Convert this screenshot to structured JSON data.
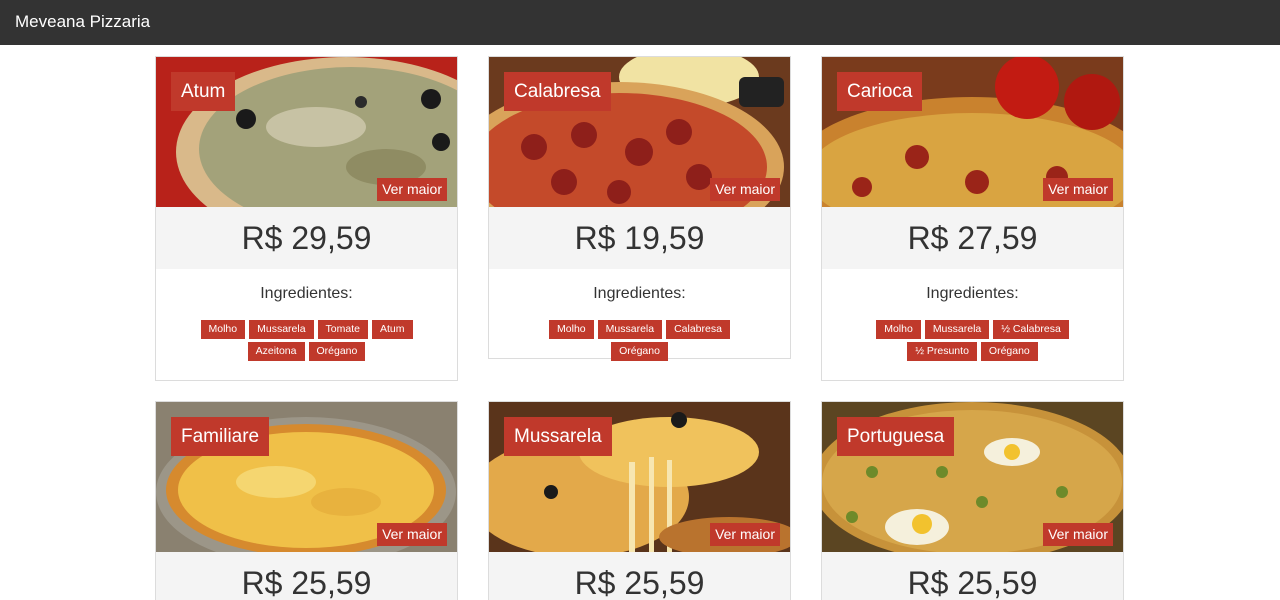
{
  "navbar": {
    "brand": "Meveana Pizzaria"
  },
  "more_label": "Ver maior",
  "ingredients_label": "Ingredientes:",
  "cards": [
    {
      "name": "Atum",
      "price": "R$ 29,59",
      "ingredients": [
        "Molho",
        "Mussarela",
        "Tomate",
        "Atum",
        "Azeitona",
        "Orégano"
      ]
    },
    {
      "name": "Calabresa",
      "price": "R$ 19,59",
      "ingredients": [
        "Molho",
        "Mussarela",
        "Calabresa",
        "Orégano"
      ]
    },
    {
      "name": "Carioca",
      "price": "R$ 27,59",
      "ingredients": [
        "Molho",
        "Mussarela",
        "½ Calabresa",
        "½ Presunto",
        "Orégano"
      ]
    },
    {
      "name": "Familiare",
      "price": "R$ 25,59"
    },
    {
      "name": "Mussarela",
      "price": "R$ 25,59"
    },
    {
      "name": "Portuguesa",
      "price": "R$ 25,59"
    }
  ],
  "colors": {
    "accent": "#c0392b",
    "navbar": "#333333",
    "price_bg": "#f4f4f4"
  }
}
